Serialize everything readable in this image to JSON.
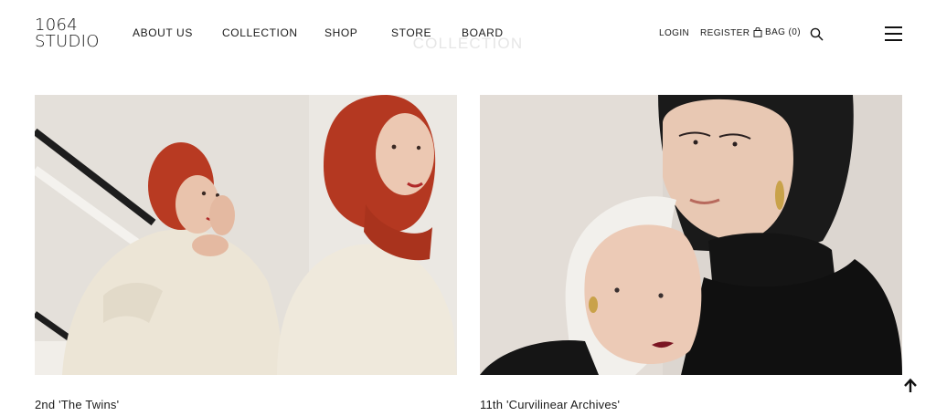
{
  "brand": {
    "line1": "1064",
    "line2": "STUDIO"
  },
  "nav": {
    "items": [
      {
        "label": "ABOUT US"
      },
      {
        "label": "COLLECTION"
      },
      {
        "label": "SHOP"
      },
      {
        "label": "STORE"
      },
      {
        "label": "BOARD"
      }
    ]
  },
  "page_title": "COLLECTION",
  "utility": {
    "login": "LOGIN",
    "register": "REGISTER",
    "bag": "BAG (0)"
  },
  "icons": {
    "bag": "bag-icon",
    "search": "search-icon",
    "menu": "hamburger-menu-icon",
    "to_top": "arrow-up-icon"
  },
  "collections": [
    {
      "caption": "2nd 'The Twins'"
    },
    {
      "caption": "11th 'Curvilinear Archives'"
    }
  ],
  "colors": {
    "text": "#111111",
    "ghost_title": "#e6e6e6",
    "knit_red": "#b83a22",
    "sweater_cream": "#ece5d6"
  }
}
